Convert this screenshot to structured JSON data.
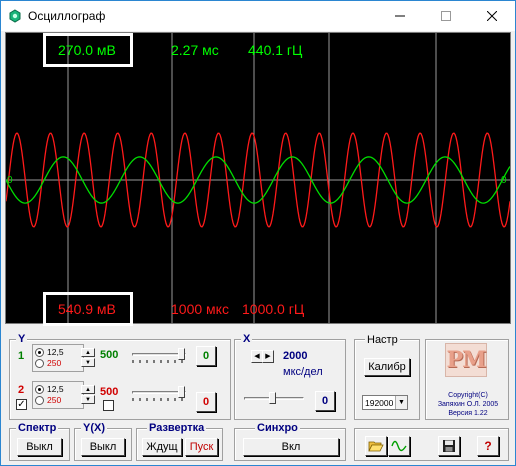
{
  "window": {
    "title": "Осциллограф",
    "colors": {
      "title_accent": "#2b86d1",
      "scope_bg": "#000000",
      "ch1": "#00dd00",
      "ch2": "#ff1a1a"
    }
  },
  "scope": {
    "ch1_readout": {
      "amplitude": "270.0 мВ",
      "time": "2.27 мс",
      "freq": "440.1 гЦ"
    },
    "ch2_readout": {
      "amplitude": "540.9 мВ",
      "time": "1000 мкс",
      "freq": "1000.0 гЦ"
    },
    "zero_marker_left": "0",
    "zero_marker_right": "0",
    "ch1_cycles_visible": 6.6,
    "ch2_cycles_visible": 15,
    "ch1_relative_amplitude": 0.33,
    "ch2_relative_amplitude": 0.67
  },
  "y_panel": {
    "label": "Y",
    "ch1": {
      "number": "1",
      "range_a": "12,5",
      "range_b": "250",
      "value": "500",
      "zero_btn": "0",
      "selected": "12,5"
    },
    "ch2": {
      "number": "2",
      "range_a": "12,5",
      "range_b": "250",
      "value": "500",
      "zero_btn": "0",
      "selected": "12,5",
      "enabled_check": "✓"
    }
  },
  "x_panel": {
    "label": "X",
    "value": "2000",
    "unit": "мкс/дел",
    "zero_btn": "0"
  },
  "settings_panel": {
    "label": "Настр",
    "calib_button": "Калибр",
    "samplerate_value": "192000"
  },
  "logo": {
    "mark": "PM",
    "copyright": "Copyright(C)",
    "author": "Запяхин О.Л. 2005",
    "version": "Версия 1.22"
  },
  "spectrum_panel": {
    "label": "Спектр",
    "button": "Выкл"
  },
  "yx_panel": {
    "label": "Y(X)",
    "button": "Выкл"
  },
  "sweep_panel": {
    "label": "Развертка",
    "wait_button": "Ждущ",
    "start_button": "Пуск"
  },
  "sync_panel": {
    "label": "Синхро",
    "button": "Вкл"
  },
  "bottom_tools": {
    "open_icon": "folder-open-icon",
    "wave_icon": "sine-wave-icon",
    "save_icon": "floppy-disk-icon",
    "help_label": "?"
  }
}
